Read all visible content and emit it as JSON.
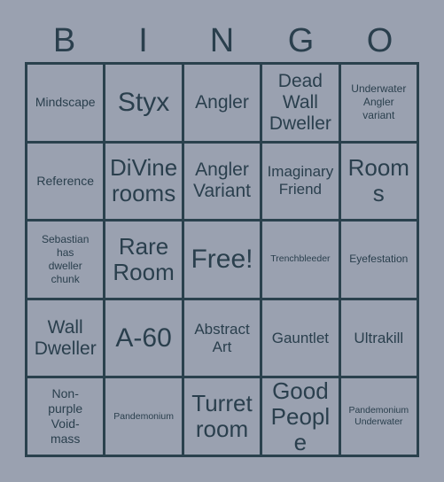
{
  "card": {
    "header_letters": [
      "B",
      "I",
      "N",
      "G",
      "O"
    ],
    "colors": {
      "background": "#9aa1b0",
      "border": "#2a414d",
      "text": "#2a3f4d"
    },
    "grid": {
      "rows": 5,
      "columns": 5,
      "free_space_label": "Free!",
      "free_space_position": "row3-col3"
    },
    "cells": [
      {
        "id": "r1c1",
        "text": "Mindscape",
        "size": "xs"
      },
      {
        "id": "r1c2",
        "text": "Styx",
        "size": "xl"
      },
      {
        "id": "r1c3",
        "text": "Angler",
        "size": "md"
      },
      {
        "id": "r1c4",
        "text": "Dead\nWall\nDweller",
        "size": "md"
      },
      {
        "id": "r1c5",
        "text": "Underwater\nAngler\nvariant",
        "size": "xxs"
      },
      {
        "id": "r2c1",
        "text": "Reference",
        "size": "xs"
      },
      {
        "id": "r2c2",
        "text": "DiVine\nrooms",
        "size": "lg"
      },
      {
        "id": "r2c3",
        "text": "Angler\nVariant",
        "size": "md"
      },
      {
        "id": "r2c4",
        "text": "Imaginary\nFriend",
        "size": "sm"
      },
      {
        "id": "r2c5",
        "text": "Rooms",
        "size": "lg"
      },
      {
        "id": "r3c1",
        "text": "Sebastian\nhas\ndweller\nchunk",
        "size": "xxs"
      },
      {
        "id": "r3c2",
        "text": "Rare\nRoom",
        "size": "lg"
      },
      {
        "id": "r3c3",
        "text": "Free!",
        "size": "xl"
      },
      {
        "id": "r3c4",
        "text": "Trenchbleeder",
        "size": "tiny"
      },
      {
        "id": "r3c5",
        "text": "Eyefestation",
        "size": "xxs"
      },
      {
        "id": "r4c1",
        "text": "Wall\nDweller",
        "size": "md"
      },
      {
        "id": "r4c2",
        "text": "A-60",
        "size": "xl"
      },
      {
        "id": "r4c3",
        "text": "Abstract\nArt",
        "size": "sm"
      },
      {
        "id": "r4c4",
        "text": "Gauntlet",
        "size": "sm"
      },
      {
        "id": "r4c5",
        "text": "Ultrakill",
        "size": "sm"
      },
      {
        "id": "r5c1",
        "text": "Non-\npurple\nVoid-\nmass",
        "size": "xs"
      },
      {
        "id": "r5c2",
        "text": "Pandemonium",
        "size": "tiny"
      },
      {
        "id": "r5c3",
        "text": "Turret\nroom",
        "size": "lg"
      },
      {
        "id": "r5c4",
        "text": "Good\nPeople",
        "size": "lg"
      },
      {
        "id": "r5c5",
        "text": "Pandemonium\nUnderwater",
        "size": "tiny"
      }
    ]
  }
}
